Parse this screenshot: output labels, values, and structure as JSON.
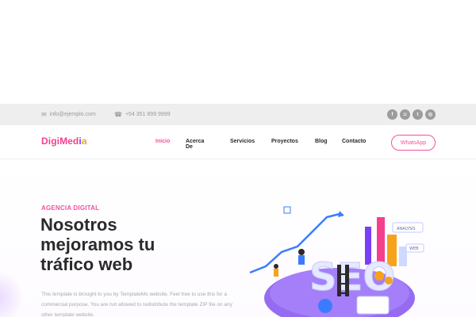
{
  "topbar": {
    "email": "info@ejemplo.com",
    "phone": "+54 351 899 9999",
    "socials": [
      {
        "name": "facebook-icon",
        "glyph": "f"
      },
      {
        "name": "instagram-icon",
        "glyph": "◘"
      },
      {
        "name": "twitter-icon",
        "glyph": "t"
      },
      {
        "name": "other-icon",
        "glyph": "◎"
      }
    ]
  },
  "navbar": {
    "logo": {
      "main": "DigiMed",
      "accent1": "i",
      "accent2": "a"
    },
    "items": [
      {
        "label": "Inicio",
        "active": true
      },
      {
        "label": "Acerca De"
      },
      {
        "label": "Servicios"
      },
      {
        "label": "Proyectos"
      },
      {
        "label": "Blog"
      },
      {
        "label": "Contacto"
      }
    ],
    "cta": "WhatsApp"
  },
  "hero": {
    "kicker": "AGENCIA DIGITAL",
    "headline_line1": "Nosotros",
    "headline_line2": "mejoramos tu",
    "headline_line3": "tráfico web",
    "description": "This template is brought to you by TemplateMo website. Feel free to use this for a commercial purpose. You are not allowed to redistribute the template ZIP file on any other template website.",
    "illustration": {
      "big_text": "SEO",
      "tags": [
        "ANALYSIS",
        "WEB"
      ]
    }
  },
  "colors": {
    "accent": "#f4519f",
    "purple": "#7a3ff4",
    "orange": "#f7a21b"
  }
}
